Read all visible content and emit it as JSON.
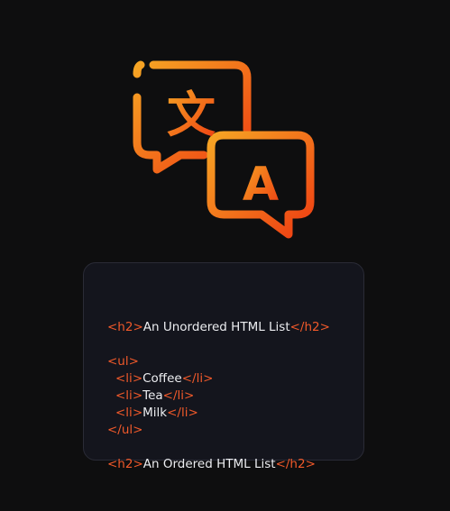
{
  "icon": {
    "name": "translate-icon",
    "glyph_top": "文",
    "glyph_bottom": "A",
    "gradient": [
      "#f6a524",
      "#ee3d12"
    ]
  },
  "code": {
    "lines": [
      {
        "open": "<h2>",
        "text": "An Unordered HTML List",
        "close": "</h2>",
        "indent": 0
      },
      {
        "open": "",
        "text": "",
        "close": "",
        "indent": 0
      },
      {
        "open": "<ul>",
        "text": "",
        "close": "",
        "indent": 0
      },
      {
        "open": "<li>",
        "text": "Coffee",
        "close": "</li>",
        "indent": 1
      },
      {
        "open": "<li>",
        "text": "Tea",
        "close": "</li>",
        "indent": 1
      },
      {
        "open": "<li>",
        "text": "Milk",
        "close": "</li>",
        "indent": 1
      },
      {
        "open": "</ul>",
        "text": "",
        "close": "",
        "indent": 0
      },
      {
        "open": "",
        "text": "",
        "close": "",
        "indent": 0
      },
      {
        "open": "<h2>",
        "text": "An Ordered HTML List",
        "close": "</h2>",
        "indent": 0
      }
    ]
  },
  "colors": {
    "background": "#0e0e0f",
    "card": "#14151d",
    "tag": "#f0592a",
    "text": "#ecedf0"
  }
}
